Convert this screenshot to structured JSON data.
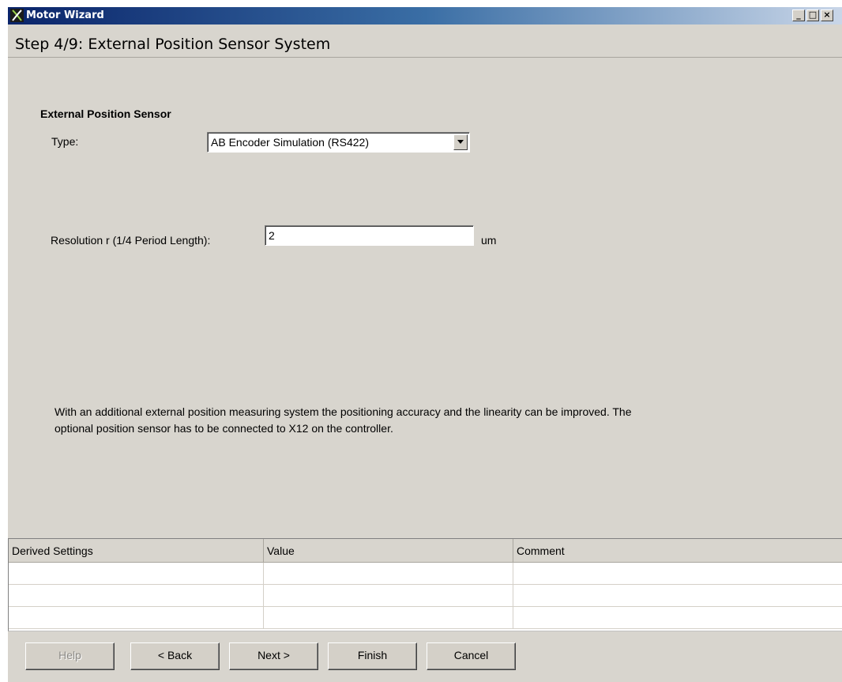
{
  "window": {
    "title": "Motor Wizard"
  },
  "step": {
    "title": "Step 4/9: External Position Sensor System"
  },
  "sensor": {
    "section_title": "External Position Sensor",
    "type_label": "Type:",
    "type_value": "AB Encoder Simulation (RS422)",
    "resolution_label": "Resolution r (1/4 Period Length):",
    "resolution_value": "2",
    "resolution_unit": "um"
  },
  "description": "With an additional external position measuring system the positioning accuracy and the linearity can be improved. The optional position sensor has to be connected to X12 on the controller.",
  "grid": {
    "columns": [
      "Derived Settings",
      "Value",
      "Comment"
    ],
    "rows": [
      [
        "",
        "",
        ""
      ],
      [
        "",
        "",
        ""
      ],
      [
        "",
        "",
        ""
      ]
    ]
  },
  "buttons": {
    "help": "Help",
    "back": "< Back",
    "next": "Next >",
    "finish": "Finish",
    "cancel": "Cancel"
  },
  "icons": {
    "app": "app-logo-icon",
    "minimize": "minimize-icon",
    "maximize": "maximize-icon",
    "close": "close-icon",
    "dropdown": "chevron-down-icon"
  }
}
